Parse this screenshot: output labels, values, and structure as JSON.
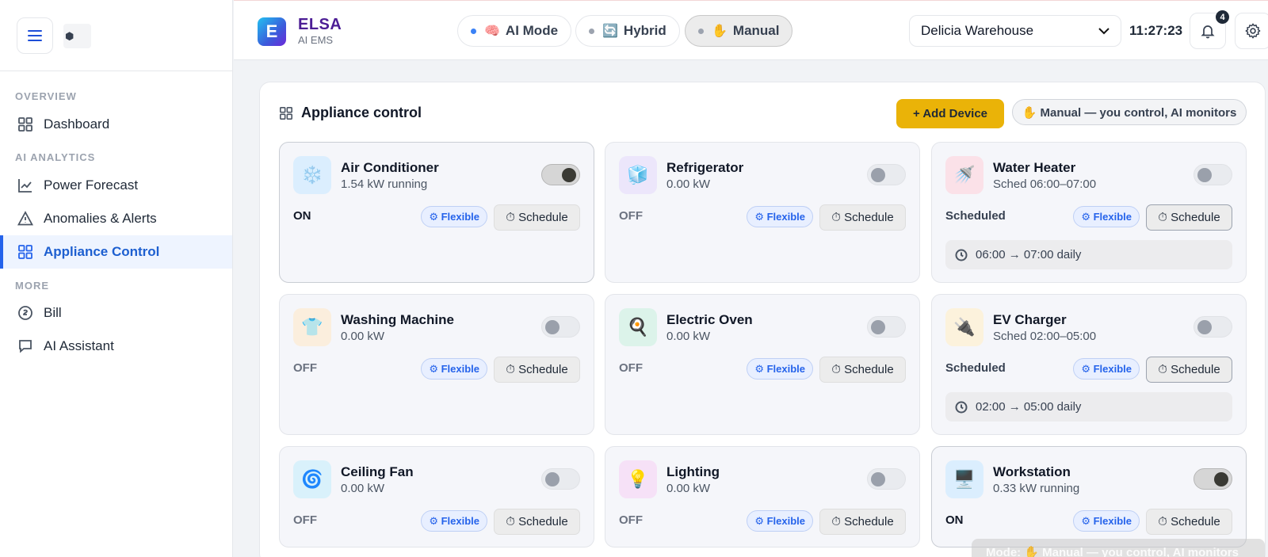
{
  "sidebar": {
    "logo_text": "⬢",
    "sections": {
      "overview": "OVERVIEW",
      "ai_analytics": "AI ANALYTICS",
      "more": "MORE"
    },
    "items": [
      {
        "label": "Dashboard",
        "icon": "grid-icon"
      },
      {
        "label": "Power Forecast",
        "icon": "line-chart-icon"
      },
      {
        "label": "Anomalies & Alerts",
        "icon": "warning-triangle-icon"
      },
      {
        "label": "Appliance Control",
        "icon": "grid-icon",
        "active": true
      },
      {
        "label": "Bill",
        "icon": "coin-icon"
      },
      {
        "label": "AI Assistant",
        "icon": "chat-icon"
      }
    ]
  },
  "header": {
    "brand_letter": "E",
    "brand_name": "ELSA",
    "brand_sub": "AI EMS",
    "modes": [
      {
        "label": "AI Mode",
        "emoji": "🧠",
        "dot_color": "#3b82f6"
      },
      {
        "label": "Hybrid",
        "emoji": "🔄",
        "dot_color": "#9ca3af"
      },
      {
        "label": "Manual",
        "emoji": "✋",
        "dot_color": "#9ca3af",
        "selected": true
      }
    ],
    "site": "Delicia Warehouse",
    "time": "11:27:23",
    "notification_count": "4"
  },
  "panel": {
    "title": "Appliance control",
    "add_button": "+ Add Device",
    "mode_note": "✋ Manual — you control, AI monitors"
  },
  "devices": [
    {
      "name": "Air Conditioner",
      "sub": "1.54 kW running",
      "state": "ON",
      "on": true,
      "emoji": "❄️",
      "icon_bg": "#dbeefe",
      "flex": "⚙ Flexible",
      "schedule": "⏱ Schedule"
    },
    {
      "name": "Refrigerator",
      "sub": "0.00 kW",
      "state": "OFF",
      "on": false,
      "emoji": "🧊",
      "icon_bg": "#ece6fb",
      "flex": "⚙ Flexible",
      "schedule": "⏱ Schedule"
    },
    {
      "name": "Water Heater",
      "sub": "Sched 06:00–07:00",
      "state": "Scheduled",
      "on": false,
      "emoji": "🚿",
      "icon_bg": "#fbe1e8",
      "flex": "⚙ Flexible",
      "schedule": "⏱ Schedule",
      "sched_text": "06:00 → 07:00 daily"
    },
    {
      "name": "Washing Machine",
      "sub": "0.00 kW",
      "state": "OFF",
      "on": false,
      "emoji": "👕",
      "icon_bg": "#fbeedd",
      "flex": "⚙ Flexible",
      "schedule": "⏱ Schedule"
    },
    {
      "name": "Electric Oven",
      "sub": "0.00 kW",
      "state": "OFF",
      "on": false,
      "emoji": "🍳",
      "icon_bg": "#dcf3ea",
      "flex": "⚙ Flexible",
      "schedule": "⏱ Schedule"
    },
    {
      "name": "EV Charger",
      "sub": "Sched 02:00–05:00",
      "state": "Scheduled",
      "on": false,
      "emoji": "🔌",
      "icon_bg": "#fcf2dc",
      "flex": "⚙ Flexible",
      "schedule": "⏱ Schedule",
      "sched_text": "02:00 → 05:00 daily"
    },
    {
      "name": "Ceiling Fan",
      "sub": "0.00 kW",
      "state": "OFF",
      "on": false,
      "emoji": "🌀",
      "icon_bg": "#d9f1fb",
      "flex": "⚙ Flexible",
      "schedule": "⏱ Schedule"
    },
    {
      "name": "Lighting",
      "sub": "0.00 kW",
      "state": "OFF",
      "on": false,
      "emoji": "💡",
      "icon_bg": "#f6e1f7",
      "flex": "⚙ Flexible",
      "schedule": "⏱ Schedule"
    },
    {
      "name": "Workstation",
      "sub": "0.33 kW running",
      "state": "ON",
      "on": true,
      "emoji": "🖥️",
      "icon_bg": "#dbeefe",
      "flex": "⚙ Flexible",
      "schedule": "⏱ Schedule"
    }
  ],
  "toast": "Mode: ✋ Manual — you control, AI monitors"
}
